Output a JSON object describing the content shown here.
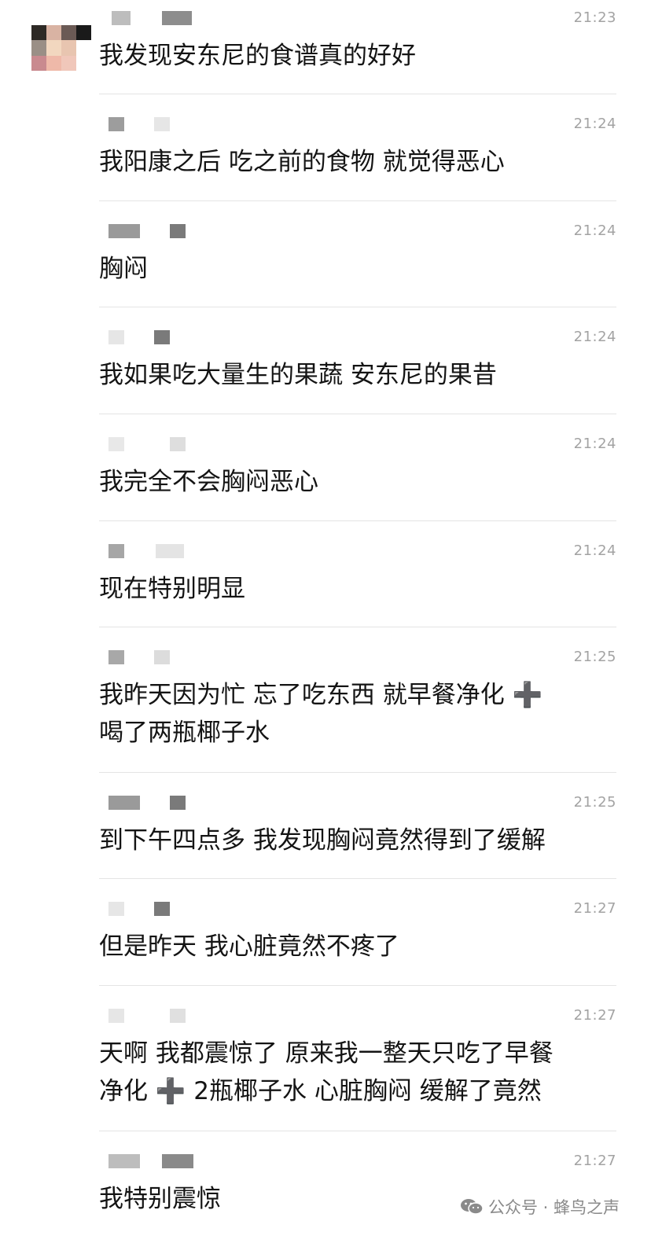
{
  "messages": [
    {
      "time": "21:23",
      "text": "我发现安东尼的食谱真的好好"
    },
    {
      "time": "21:24",
      "text": "我阳康之后 吃之前的食物 就觉得恶心"
    },
    {
      "time": "21:24",
      "text": "胸闷"
    },
    {
      "time": "21:24",
      "text": "我如果吃大量生的果蔬 安东尼的果昔"
    },
    {
      "time": "21:24",
      "text": "我完全不会胸闷恶心"
    },
    {
      "time": "21:24",
      "text": "现在特别明显"
    },
    {
      "time": "21:25",
      "text": "我昨天因为忙 忘了吃东西 就早餐净化 ➕\n喝了两瓶椰子水"
    },
    {
      "time": "21:25",
      "text": "到下午四点多 我发现胸闷竟然得到了缓解"
    },
    {
      "time": "21:27",
      "text": "但是昨天 我心脏竟然不疼了"
    },
    {
      "time": "21:27",
      "text": "天啊 我都震惊了 原来我一整天只吃了早餐\n净化 ➕ 2瓶椰子水 心脏胸闷 缓解了竟然"
    },
    {
      "time": "21:27",
      "text": "我特别震惊"
    }
  ],
  "watermark": {
    "icon": "wechat-icon",
    "text": "公众号 · 蜂鸟之声"
  }
}
